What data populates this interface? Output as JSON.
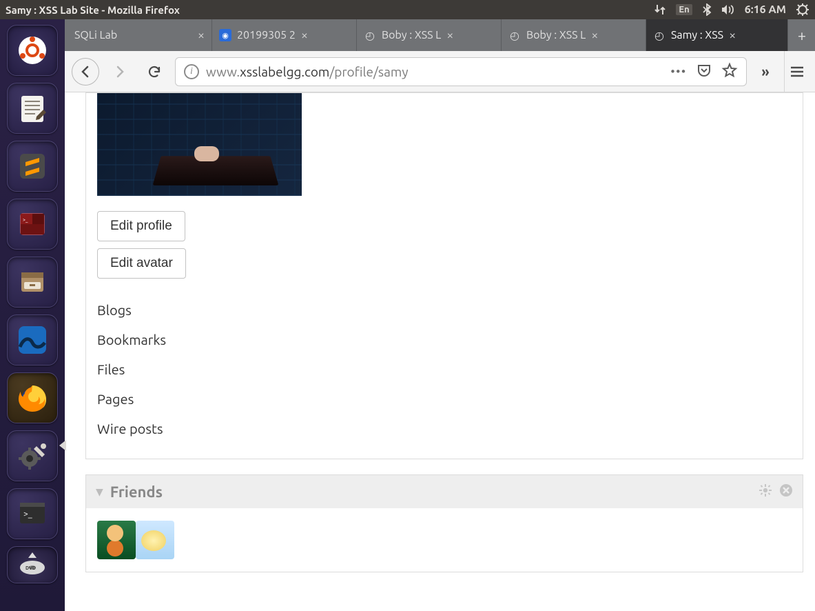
{
  "system": {
    "window_title": "Samy : XSS Lab Site - Mozilla Firefox",
    "lang_indicator": "En",
    "time": "6:16 AM"
  },
  "launcher_icons": [
    "dash-home",
    "text-editor",
    "sublime-text",
    "terminator",
    "file-manager",
    "wireshark",
    "firefox",
    "system-settings",
    "terminal",
    "disc-unmount"
  ],
  "browser": {
    "tabs": [
      {
        "label": "SQLi Lab",
        "favicon": "none"
      },
      {
        "label": "20199305 2",
        "favicon": "blue-square"
      },
      {
        "label": "Boby : XSS L",
        "favicon": "elgg"
      },
      {
        "label": "Boby : XSS L",
        "favicon": "elgg"
      },
      {
        "label": "Samy : XSS",
        "favicon": "elgg",
        "active": true
      }
    ],
    "url_prefix": "www.",
    "url_host": "xsslabelgg.com",
    "url_path": "/profile/samy"
  },
  "profile": {
    "edit_profile_label": "Edit profile",
    "edit_avatar_label": "Edit avatar",
    "links": [
      "Blogs",
      "Bookmarks",
      "Files",
      "Pages",
      "Wire posts"
    ]
  },
  "friends": {
    "heading": "Friends",
    "items": [
      "friend-1",
      "friend-2"
    ]
  }
}
